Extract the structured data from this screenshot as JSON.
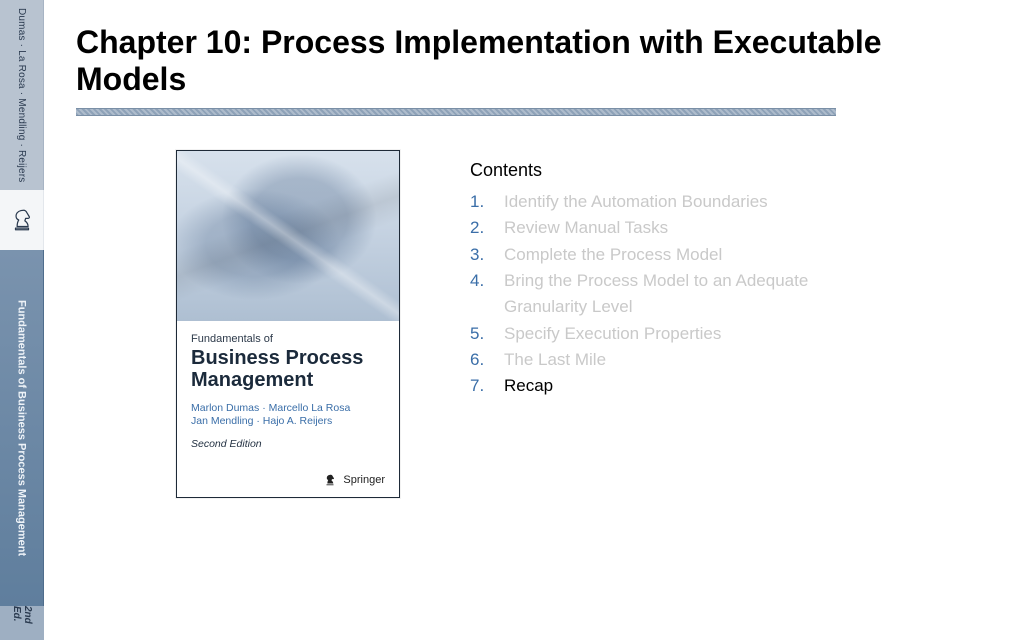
{
  "header": {
    "title": "Chapter 10: Process Implementation with Executable Models"
  },
  "spine": {
    "authors": "Dumas · La Rosa · Mendling · Reijers",
    "book_title": "Fundamentals of Business Process Management",
    "edition": "2nd Ed."
  },
  "cover": {
    "kicker": "Fundamentals of",
    "title": "Business Process Management",
    "authors_line1": "Marlon Dumas · Marcello La Rosa",
    "authors_line2": "Jan Mendling · Hajo A. Reijers",
    "edition": "Second Edition",
    "publisher": "Springer"
  },
  "contents": {
    "heading": "Contents",
    "items": [
      {
        "num": "1.",
        "label": "Identify the Automation Boundaries",
        "active": false
      },
      {
        "num": "2.",
        "label": "Review Manual Tasks",
        "active": false
      },
      {
        "num": "3.",
        "label": "Complete the Process Model",
        "active": false
      },
      {
        "num": "4.",
        "label": "Bring the Process Model to an Adequate Granularity Level",
        "active": false
      },
      {
        "num": "5.",
        "label": "Specify Execution Properties",
        "active": false
      },
      {
        "num": "6.",
        "label": "The Last Mile",
        "active": false
      },
      {
        "num": "7.",
        "label": "Recap",
        "active": true
      }
    ]
  }
}
